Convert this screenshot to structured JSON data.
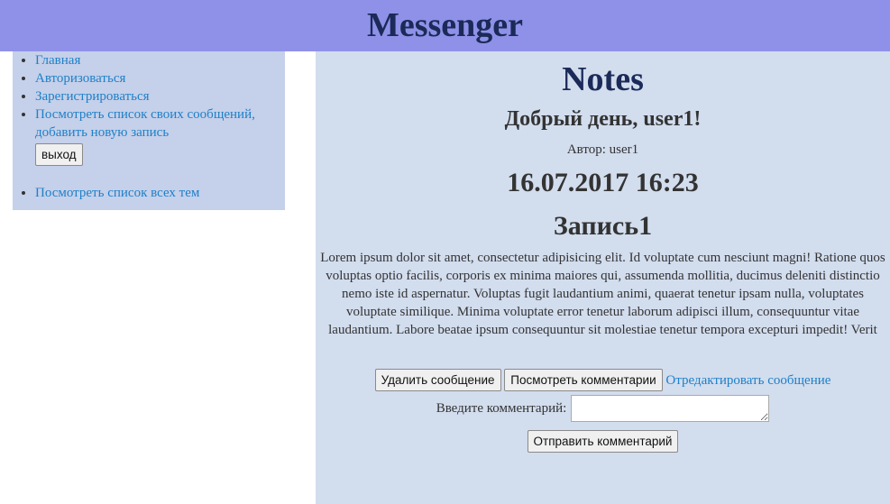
{
  "header": {
    "title": "Messenger"
  },
  "sidebar": {
    "menu": [
      {
        "label": "Главная"
      },
      {
        "label": "Авторизоваться"
      },
      {
        "label": "Зарегистрироваться"
      },
      {
        "label": "Посмотреть список своих сообщений, добавить новую запись"
      }
    ],
    "logout_label": "выход",
    "menu2": [
      {
        "label": "Посмотреть список всех тем"
      }
    ]
  },
  "main": {
    "title": "Notes",
    "greeting": "Добрый день, user1!",
    "author": "Автор: user1",
    "datetime": "16.07.2017 16:23",
    "record_title": "Запись1",
    "body": "Lorem ipsum dolor sit amet, consectetur adipisicing elit. Id voluptate cum nesciunt magni! Ratione quos voluptas optio facilis, corporis ex minima maiores qui, assumenda mollitia, ducimus deleniti distinctio nemo iste id aspernatur. Voluptas fugit laudantium animi, quaerat tenetur ipsam nulla, voluptates voluptate similique. Minima voluptate error tenetur laborum adipisci illum, consequuntur vitae laudantium. Labore beatae ipsum consequuntur sit molestiae tenetur tempora excepturi impedit! Verit",
    "delete_label": "Удалить сообщение",
    "view_comments_label": "Посмотреть комментарии",
    "edit_link": "Отредактировать сообщение",
    "comment_label": "Введите комментарий:",
    "comment_value": "",
    "send_label": "Отправить комментарий"
  }
}
